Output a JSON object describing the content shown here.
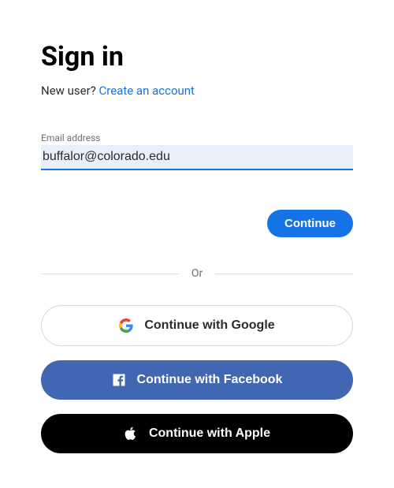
{
  "title": "Sign in",
  "newUserPrefix": "New user? ",
  "createAccount": "Create an account",
  "emailLabel": "Email address",
  "emailValue": "buffalor@colorado.edu",
  "continueLabel": "Continue",
  "dividerText": "Or",
  "googleLabel": "Continue with Google",
  "facebookLabel": "Continue with Facebook",
  "appleLabel": "Continue with Apple"
}
